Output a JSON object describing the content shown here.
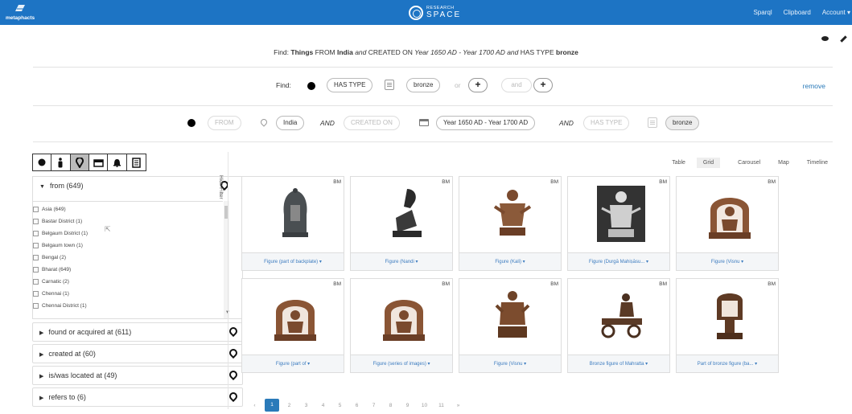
{
  "header": {
    "logo_text": "metaphacts",
    "brand_top": "RESEARCH",
    "brand_bottom": "SPACE",
    "nav": [
      "Sparql",
      "Clipboard",
      "Account ▾"
    ]
  },
  "summary": {
    "prefix": "Find: ",
    "things": "Things",
    "from_kw": " FROM ",
    "place": "India",
    "and1": " and ",
    "created": "CREATED ON ",
    "dates": "Year 1650 AD - Year 1700 AD",
    "and2": " and ",
    "has_type": "HAS TYPE ",
    "type": "bronze"
  },
  "find_row": {
    "label": "Find:",
    "has_type": "HAS TYPE",
    "value": "bronze",
    "or": "or",
    "and": "and",
    "plus": "+",
    "remove": "remove"
  },
  "criteria_row": {
    "from": "FROM",
    "place": "India",
    "and": "AND",
    "created_on": "CREATED ON",
    "dates": "Year 1650 AD - Year 1700 AD",
    "has_type": "HAS TYPE",
    "type": "bronze"
  },
  "filters": {
    "hide_filter": "Hide Filter",
    "open_facet": "from (649)",
    "values": [
      "Asia (649)",
      "Bastar District (1)",
      "Belgaum District (1)",
      "Belgaum town (1)",
      "Bengal (2)",
      "Bharat (649)",
      "Carnatic (2)",
      "Chennai (1)",
      "Chennai District (1)"
    ],
    "facets": [
      "found or acquired at (611)",
      "created at (60)",
      "is/was located at (49)",
      "refers to (6)"
    ]
  },
  "view_tabs": [
    "Table",
    "Grid",
    "Carousel",
    "Map",
    "Timeline"
  ],
  "active_tab": "Grid",
  "results": [
    {
      "source": "BM",
      "caption": "Figure (part of backplate) ▾"
    },
    {
      "source": "BM",
      "caption": "Figure (Nandi ▾"
    },
    {
      "source": "BM",
      "caption": "Figure (Kali) ▾"
    },
    {
      "source": "BM",
      "caption": "Figure (Durgā Mahiṣāsu... ▾"
    },
    {
      "source": "BM",
      "caption": "Figure (Visnu ▾"
    },
    {
      "source": "BM",
      "caption": "Figure (part of ▾"
    },
    {
      "source": "BM",
      "caption": "Figure (series of images) ▾"
    },
    {
      "source": "BM",
      "caption": "Figure (Visnu ▾"
    },
    {
      "source": "BM",
      "caption": "Bronze figure of Mahratta ▾"
    },
    {
      "source": "BM",
      "caption": "Part of bronze figure (ba... ▾"
    }
  ],
  "pager": [
    "‹",
    "1",
    "2",
    "3",
    "4",
    "5",
    "6",
    "7",
    "8",
    "9",
    "10",
    "11",
    "»"
  ],
  "colors": {
    "topbar": "#1d74c4",
    "link": "#2a7ab9"
  }
}
